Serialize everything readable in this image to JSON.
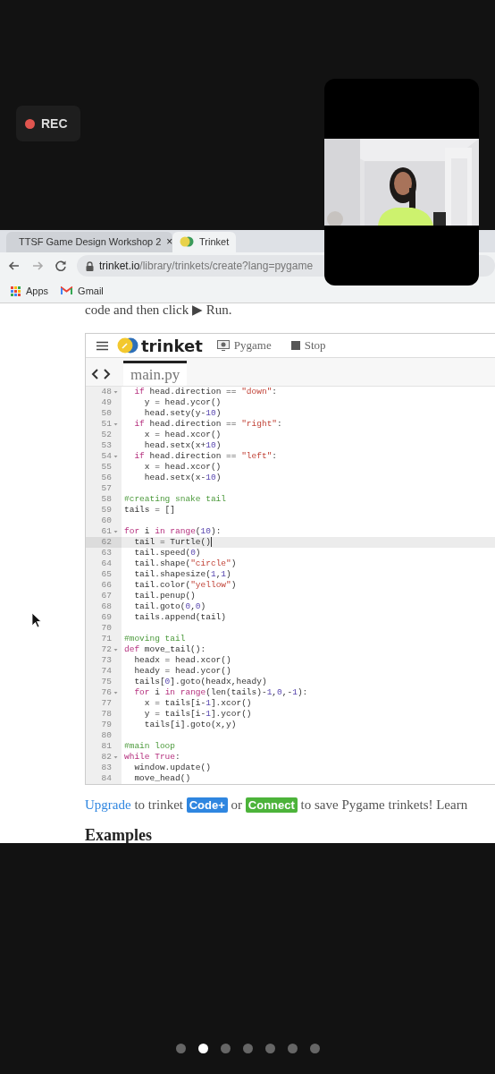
{
  "recording": {
    "label": "REC"
  },
  "browser": {
    "tabs": [
      {
        "title": "TTSF Game Design Workshop 2",
        "close": "×",
        "selected": false,
        "kind": "slides"
      },
      {
        "title": "Trinket",
        "selected": true,
        "kind": "trinket"
      }
    ],
    "address": {
      "domain": "trinket.io",
      "path": "/library/trinkets/create?lang=pygame"
    },
    "bookmarks": [
      {
        "label": "Apps",
        "kind": "apps"
      },
      {
        "label": "Gmail",
        "kind": "mail"
      }
    ]
  },
  "page": {
    "intro": "code and then click ▶ Run.",
    "editor": {
      "logo": "trinket",
      "mode": "Pygame",
      "stop": "Stop",
      "tabs": [
        {
          "label": "main.py",
          "selected": true
        }
      ],
      "lines": [
        {
          "num": "48",
          "fold": true,
          "current": false,
          "code": [
            {
              "kind": "kw",
              "text": "  if"
            },
            " head.direction == ",
            {
              "kind": "str",
              "text": "\"down\""
            },
            ":"
          ]
        },
        {
          "num": "49",
          "fold": false,
          "current": false,
          "code": [
            "    y = head.ycor()"
          ]
        },
        {
          "num": "50",
          "fold": false,
          "current": false,
          "code": [
            "    head.sety(y-",
            {
              "kind": "num",
              "text": "10"
            },
            ")"
          ]
        },
        {
          "num": "51",
          "fold": true,
          "current": false,
          "code": [
            {
              "kind": "kw",
              "text": "  if"
            },
            " head.direction == ",
            {
              "kind": "str",
              "text": "\"right\""
            },
            ":"
          ]
        },
        {
          "num": "52",
          "fold": false,
          "current": false,
          "code": [
            "    x = head.xcor()"
          ]
        },
        {
          "num": "53",
          "fold": false,
          "current": false,
          "code": [
            "    head.setx(x+",
            {
              "kind": "num",
              "text": "10"
            },
            ")"
          ]
        },
        {
          "num": "54",
          "fold": true,
          "current": false,
          "code": [
            {
              "kind": "kw",
              "text": "  if"
            },
            " head.direction == ",
            {
              "kind": "str",
              "text": "\"left\""
            },
            ":"
          ]
        },
        {
          "num": "55",
          "fold": false,
          "current": false,
          "code": [
            "    x = head.xcor()"
          ]
        },
        {
          "num": "56",
          "fold": false,
          "current": false,
          "code": [
            "    head.setx(x-",
            {
              "kind": "num",
              "text": "10"
            },
            ")"
          ]
        },
        {
          "num": "57",
          "fold": false,
          "current": false
        },
        {
          "num": "58",
          "fold": false,
          "current": false,
          "code": [
            {
              "kind": "com",
              "text": "#creating snake tail"
            }
          ]
        },
        {
          "num": "59",
          "fold": false,
          "current": false,
          "code": [
            "tails = []"
          ]
        },
        {
          "num": "60",
          "fold": false,
          "current": false
        },
        {
          "num": "61",
          "fold": true,
          "current": false,
          "code": [
            {
              "kind": "kw",
              "text": "for"
            },
            " i ",
            {
              "kind": "kw",
              "text": "in range"
            },
            "(",
            {
              "kind": "num",
              "text": "10"
            },
            "):"
          ]
        },
        {
          "num": "62",
          "fold": false,
          "current": true,
          "code": [
            "  tail = Turtle()"
          ]
        },
        {
          "num": "63",
          "fold": false,
          "current": false,
          "code": [
            "  tail.speed(",
            {
              "kind": "num",
              "text": "0"
            },
            ")"
          ]
        },
        {
          "num": "64",
          "fold": false,
          "current": false,
          "code": [
            "  tail.shape(",
            {
              "kind": "str",
              "text": "\"circle\""
            },
            ")"
          ]
        },
        {
          "num": "65",
          "fold": false,
          "current": false,
          "code": [
            "  tail.shapesize(",
            {
              "kind": "num",
              "text": "1"
            },
            ",",
            {
              "kind": "num",
              "text": "1"
            },
            ")"
          ]
        },
        {
          "num": "66",
          "fold": false,
          "current": false,
          "code": [
            "  tail.color(",
            {
              "kind": "str",
              "text": "\"yellow\""
            },
            ")"
          ]
        },
        {
          "num": "67",
          "fold": false,
          "current": false,
          "code": [
            "  tail.penup()"
          ]
        },
        {
          "num": "68",
          "fold": false,
          "current": false,
          "code": [
            "  tail.goto(",
            {
              "kind": "num",
              "text": "0"
            },
            ",",
            {
              "kind": "num",
              "text": "0"
            },
            ")"
          ]
        },
        {
          "num": "69",
          "fold": false,
          "current": false,
          "code": [
            "  tails.append(tail)"
          ]
        },
        {
          "num": "70",
          "fold": false,
          "current": false
        },
        {
          "num": "71",
          "fold": false,
          "current": false,
          "code": [
            {
              "kind": "com",
              "text": "#moving tail"
            }
          ]
        },
        {
          "num": "72",
          "fold": true,
          "current": false,
          "code": [
            {
              "kind": "kw",
              "text": "def"
            },
            " move_tail():"
          ]
        },
        {
          "num": "73",
          "fold": false,
          "current": false,
          "code": [
            "  headx = head.xcor()"
          ]
        },
        {
          "num": "74",
          "fold": false,
          "current": false,
          "code": [
            "  heady = head.ycor()"
          ]
        },
        {
          "num": "75",
          "fold": false,
          "current": false,
          "code": [
            "  tails[",
            {
              "kind": "num",
              "text": "0"
            },
            "].goto(headx,heady)"
          ]
        },
        {
          "num": "76",
          "fold": true,
          "current": false,
          "code": [
            {
              "kind": "kw",
              "text": "  for"
            },
            " i ",
            {
              "kind": "kw",
              "text": "in range"
            },
            "(len(tails)-",
            {
              "kind": "num",
              "text": "1"
            },
            ",",
            {
              "kind": "num",
              "text": "0"
            },
            ",-",
            {
              "kind": "num",
              "text": "1"
            },
            "):"
          ]
        },
        {
          "num": "77",
          "fold": false,
          "current": false,
          "code": [
            "    x = tails[i-",
            {
              "kind": "num",
              "text": "1"
            },
            "].xcor()"
          ]
        },
        {
          "num": "78",
          "fold": false,
          "current": false,
          "code": [
            "    y = tails[i-",
            {
              "kind": "num",
              "text": "1"
            },
            "].ycor()"
          ]
        },
        {
          "num": "79",
          "fold": false,
          "current": false,
          "code": [
            "    tails[i].goto(x,y)"
          ]
        },
        {
          "num": "80",
          "fold": false,
          "current": false
        },
        {
          "num": "81",
          "fold": false,
          "current": false,
          "code": [
            {
              "kind": "com",
              "text": "#main loop"
            }
          ]
        },
        {
          "num": "82",
          "fold": true,
          "current": false,
          "code": [
            {
              "kind": "kw",
              "text": "while True"
            },
            ":"
          ]
        },
        {
          "num": "83",
          "fold": false,
          "current": false,
          "code": [
            "  window.update()"
          ]
        },
        {
          "num": "84",
          "fold": false,
          "current": false,
          "code": [
            "  move_head()"
          ]
        }
      ]
    },
    "notice": [
      {
        "kind": "link",
        "text": "Upgrade"
      },
      {
        "kind": "text",
        "text": " to trinket "
      },
      {
        "kind": "badge",
        "text": "Code+",
        "color": "#2f86e0"
      },
      {
        "kind": "text",
        "text": " or "
      },
      {
        "kind": "badge",
        "text": "Connect",
        "color": "#4cb33a"
      },
      {
        "kind": "text",
        "text": " to save Pygame trinkets! Learn"
      }
    ],
    "heading": "Examples"
  },
  "pager": [
    {
      "selected": false
    },
    {
      "selected": true
    },
    {
      "selected": false
    },
    {
      "selected": false
    },
    {
      "selected": false
    },
    {
      "selected": false
    },
    {
      "selected": false
    }
  ]
}
